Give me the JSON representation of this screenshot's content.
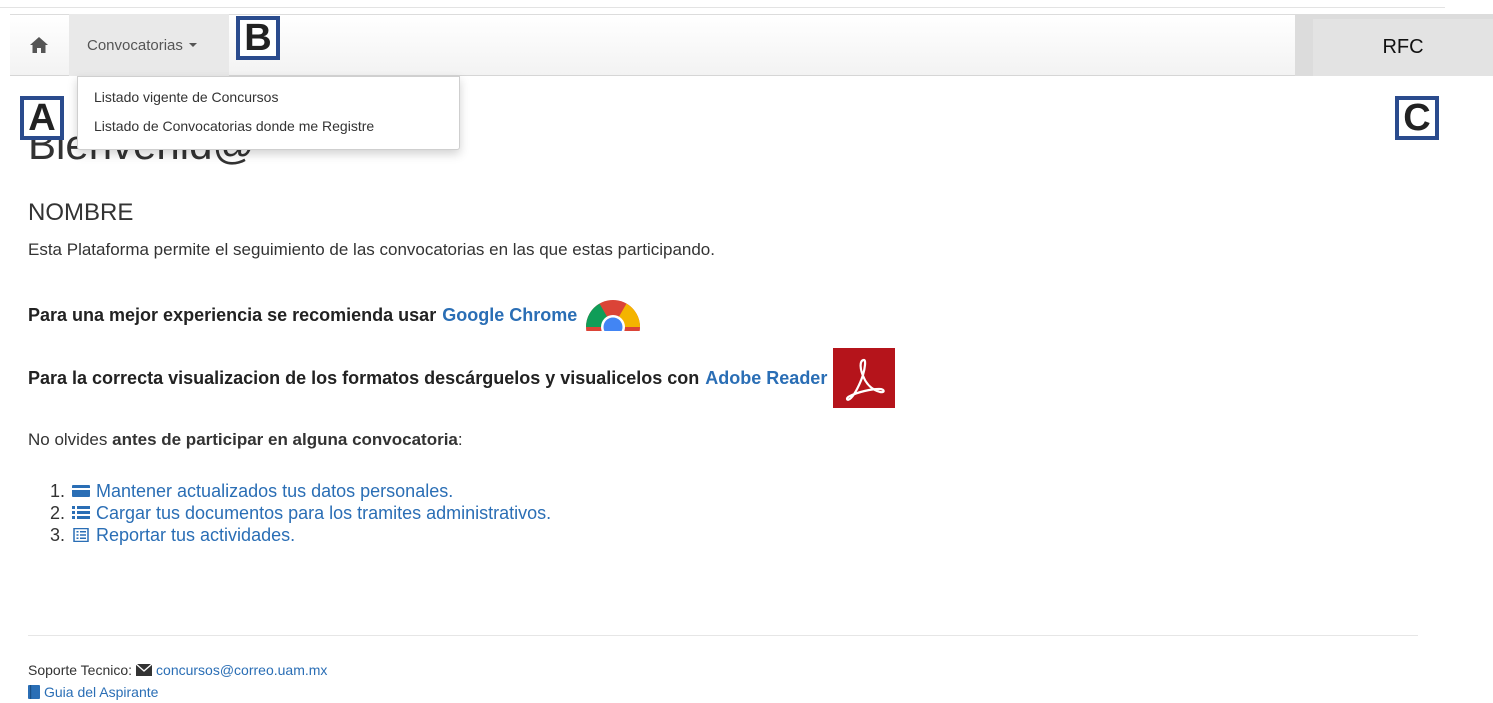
{
  "navbar": {
    "home_icon": "home-icon",
    "menu_label": "Convocatorias",
    "rfc_label": "RFC"
  },
  "dropdown": {
    "items": [
      "Listado vigente de Concursos",
      "Listado de Convocatorias donde me Registre"
    ]
  },
  "callouts": {
    "a": "A",
    "b": "B",
    "c": "C"
  },
  "main": {
    "welcome": "Bienvenid@",
    "name": "NOMBRE",
    "description": "Esta Plataforma permite el seguimiento de las convocatorias en las que estas participando.",
    "chrome_text": "Para una mejor experiencia se recomienda usar",
    "chrome_link": "Google Chrome",
    "adobe_text": "Para la correcta visualizacion de los formatos descárguelos y visualicelos con",
    "adobe_link": "Adobe Reader",
    "reminder_prefix": "No olvides",
    "reminder_bold": "antes de participar en alguna convocatoria",
    "reminder_suffix": ":",
    "steps": [
      {
        "num": "1.",
        "icon": "credit-card-icon",
        "text": "Mantener actualizados tus datos personales."
      },
      {
        "num": "2.",
        "icon": "list-icon",
        "text": "Cargar tus documentos para los tramites administrativos."
      },
      {
        "num": "3.",
        "icon": "list-alt-icon",
        "text": "Reportar tus actividades."
      }
    ]
  },
  "footer": {
    "support_label": "Soporte Tecnico:",
    "support_email": "concursos@correo.uam.mx",
    "guide_link": "Guia del Aspirante"
  },
  "colors": {
    "link": "#2a6eb5",
    "callout_border": "#2a4b8d",
    "adobe_red": "#b5141b"
  }
}
